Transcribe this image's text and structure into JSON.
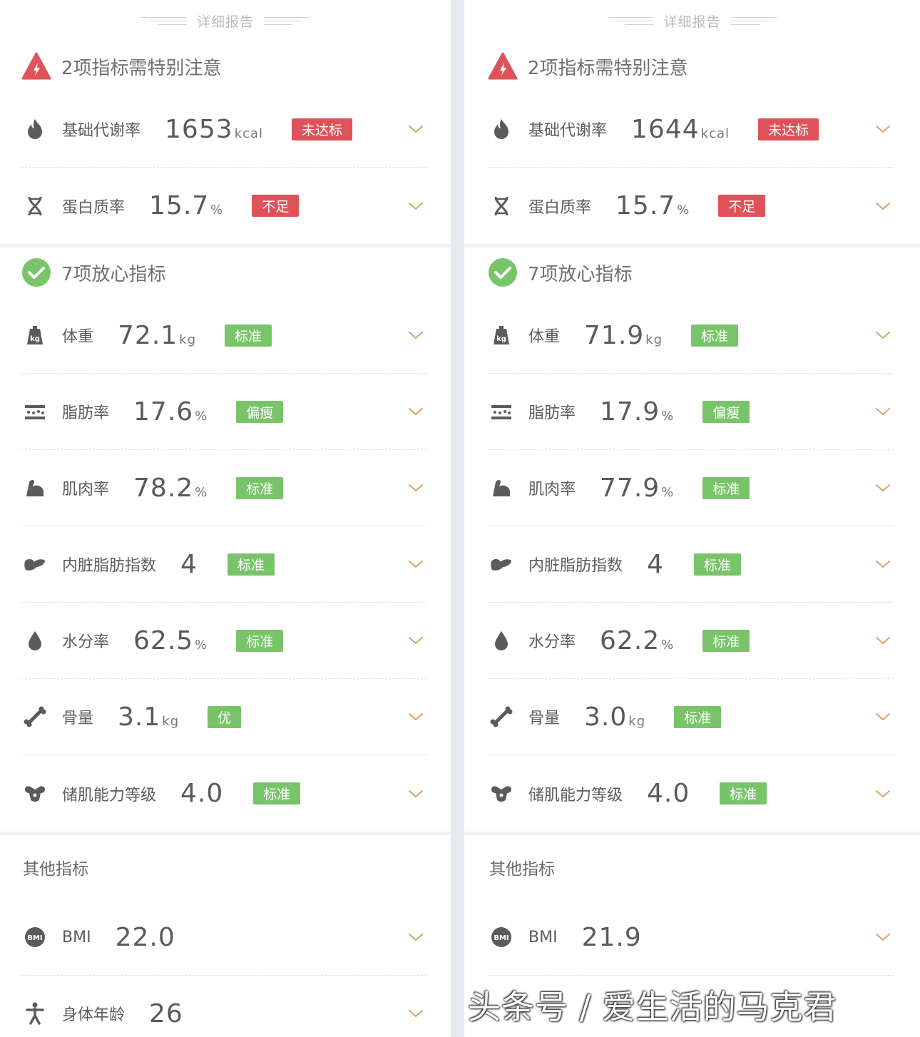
{
  "colors": {
    "warn": "#e0525a",
    "ok": "#79c46a",
    "chevron": "#d6a46a"
  },
  "left": {
    "report_title": "详细报告",
    "warn_section": {
      "title": "2项指标需特别注意",
      "rows": [
        {
          "icon": "flame-icon",
          "label": "基础代谢率",
          "value": "1653",
          "unit": "kcal",
          "status": "未达标"
        },
        {
          "icon": "protein-dna-icon",
          "label": "蛋白质率",
          "value": "15.7",
          "unit": "%",
          "status": "不足"
        }
      ]
    },
    "ok_section": {
      "title": "7项放心指标",
      "rows": [
        {
          "icon": "weight-kg-icon",
          "label": "体重",
          "value": "72.1",
          "unit": "kg",
          "status": "标准"
        },
        {
          "icon": "fat-layer-icon",
          "label": "脂肪率",
          "value": "17.6",
          "unit": "%",
          "status": "偏瘦"
        },
        {
          "icon": "muscle-arm-icon",
          "label": "肌肉率",
          "value": "78.2",
          "unit": "%",
          "status": "标准"
        },
        {
          "icon": "visceral-organ-icon",
          "label": "内脏脂肪指数",
          "value": "4",
          "unit": "",
          "status": "标准"
        },
        {
          "icon": "water-drop-icon",
          "label": "水分率",
          "value": "62.5",
          "unit": "%",
          "status": "标准"
        },
        {
          "icon": "bone-icon",
          "label": "骨量",
          "value": "3.1",
          "unit": "kg",
          "status": "优"
        },
        {
          "icon": "muscle-storage-icon",
          "label": "储肌能力等级",
          "value": "4.0",
          "unit": "",
          "status": "标准"
        }
      ]
    },
    "other_section": {
      "title": "其他指标",
      "rows": [
        {
          "icon": "bmi-icon",
          "label": "BMI",
          "value": "22.0",
          "unit": ""
        },
        {
          "icon": "body-age-icon",
          "label": "身体年龄",
          "value": "26",
          "unit": ""
        }
      ]
    }
  },
  "right": {
    "report_title": "详细报告",
    "warn_section": {
      "title": "2项指标需特别注意",
      "rows": [
        {
          "icon": "flame-icon",
          "label": "基础代谢率",
          "value": "1644",
          "unit": "kcal",
          "status": "未达标"
        },
        {
          "icon": "protein-dna-icon",
          "label": "蛋白质率",
          "value": "15.7",
          "unit": "%",
          "status": "不足"
        }
      ]
    },
    "ok_section": {
      "title": "7项放心指标",
      "rows": [
        {
          "icon": "weight-kg-icon",
          "label": "体重",
          "value": "71.9",
          "unit": "kg",
          "status": "标准"
        },
        {
          "icon": "fat-layer-icon",
          "label": "脂肪率",
          "value": "17.9",
          "unit": "%",
          "status": "偏瘦"
        },
        {
          "icon": "muscle-arm-icon",
          "label": "肌肉率",
          "value": "77.9",
          "unit": "%",
          "status": "标准"
        },
        {
          "icon": "visceral-organ-icon",
          "label": "内脏脂肪指数",
          "value": "4",
          "unit": "",
          "status": "标准"
        },
        {
          "icon": "water-drop-icon",
          "label": "水分率",
          "value": "62.2",
          "unit": "%",
          "status": "标准"
        },
        {
          "icon": "bone-icon",
          "label": "骨量",
          "value": "3.0",
          "unit": "kg",
          "status": "标准"
        },
        {
          "icon": "muscle-storage-icon",
          "label": "储肌能力等级",
          "value": "4.0",
          "unit": "",
          "status": "标准"
        }
      ]
    },
    "other_section": {
      "title": "其他指标",
      "rows": [
        {
          "icon": "bmi-icon",
          "label": "BMI",
          "value": "21.9",
          "unit": ""
        }
      ]
    }
  },
  "watermark": "头条号 / 爱生活的马克君"
}
